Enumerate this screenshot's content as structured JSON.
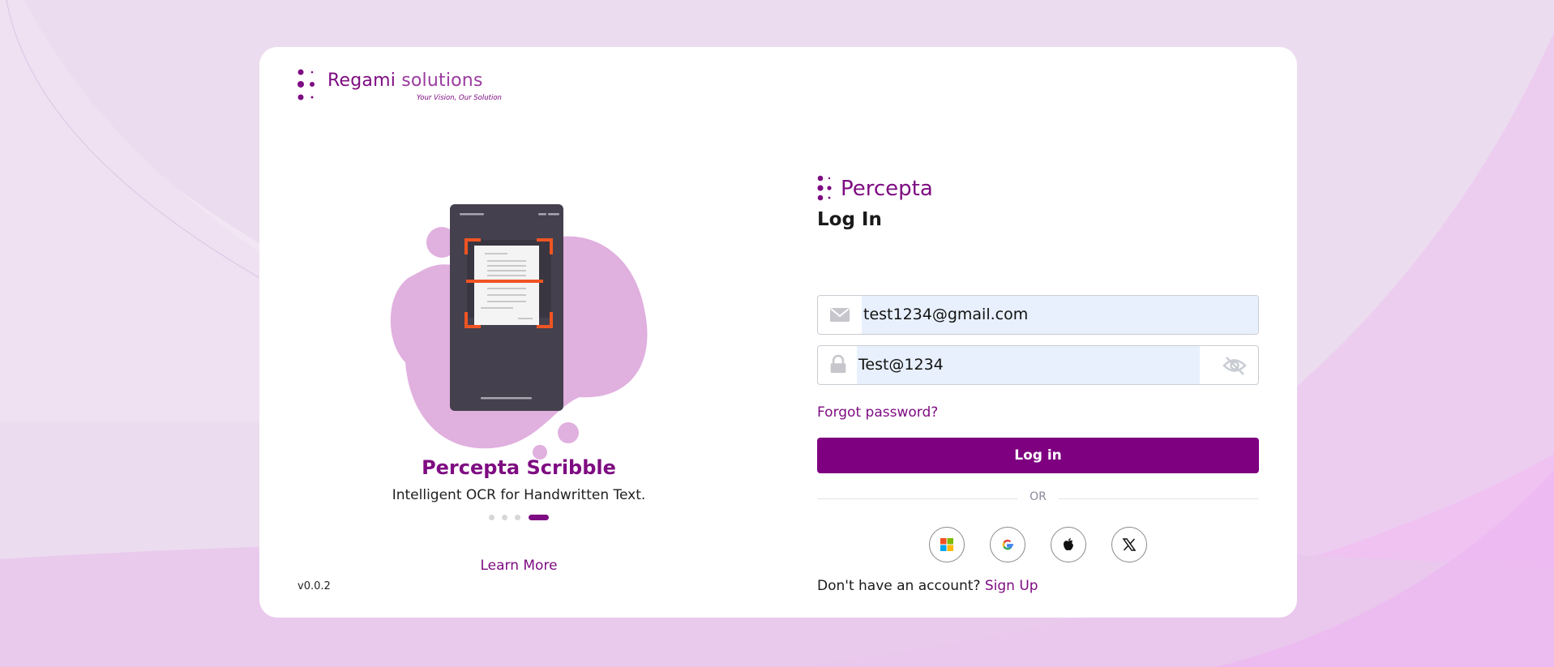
{
  "colors": {
    "brand": "#7e0c82",
    "button": "#7e0080",
    "background": "#eedff0",
    "autofill": "#e8f0fd"
  },
  "brand": {
    "name": "Regami",
    "name_suffix": "solutions",
    "tagline": "Your Vision, Our Solution"
  },
  "promo": {
    "title": "Percepta Scribble",
    "subtitle": "Intelligent OCR for Handwritten Text.",
    "carousel": {
      "total": 4,
      "active_index": 3
    },
    "learn_more": "Learn More"
  },
  "version": "v0.0.2",
  "login": {
    "product_name": "Percepta",
    "title": "Log In",
    "email": {
      "value": "test1234@gmail.com",
      "icon": "envelope-icon"
    },
    "password": {
      "value": "Test@1234",
      "icon": "lock-icon",
      "toggle_icon": "eye-off-icon"
    },
    "forgot_password": "Forgot password?",
    "login_button": "Log in",
    "divider": "OR",
    "social": [
      {
        "name": "microsoft",
        "icon": "microsoft-icon"
      },
      {
        "name": "google",
        "icon": "google-icon"
      },
      {
        "name": "apple",
        "icon": "apple-icon"
      },
      {
        "name": "x",
        "icon": "x-icon"
      }
    ],
    "signup_prompt": "Don't have an account?",
    "signup_link": "Sign Up"
  }
}
